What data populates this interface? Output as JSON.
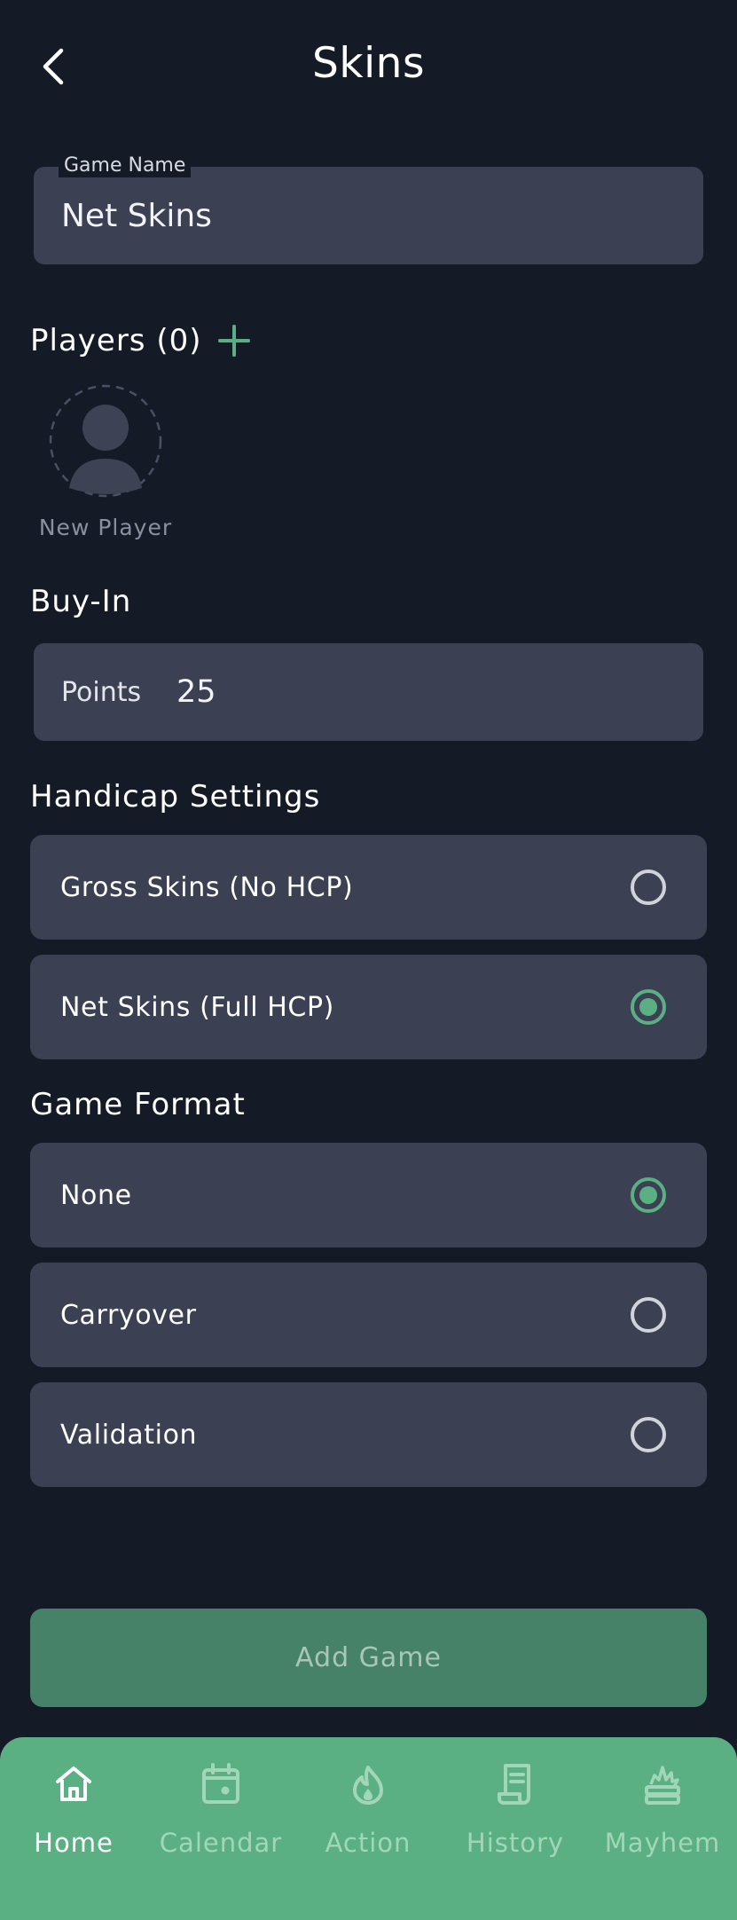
{
  "header": {
    "title": "Skins",
    "back_icon": "chevron-left-icon"
  },
  "game_name": {
    "label": "Game Name",
    "value": "Net Skins"
  },
  "players": {
    "title": "Players (0)",
    "add_icon": "plus-icon",
    "new_player_label": "New Player",
    "avatar_icon": "person-icon"
  },
  "buy_in": {
    "title": "Buy-In",
    "prefix": "Points",
    "value": "25"
  },
  "handicap": {
    "title": "Handicap Settings",
    "options": [
      {
        "label": "Gross Skins (No HCP)",
        "selected": false
      },
      {
        "label": "Net Skins (Full HCP)",
        "selected": true
      }
    ]
  },
  "format": {
    "title": "Game Format",
    "options": [
      {
        "label": "None",
        "selected": true
      },
      {
        "label": "Carryover",
        "selected": false
      },
      {
        "label": "Validation",
        "selected": false
      }
    ]
  },
  "action": {
    "add_game_label": "Add Game"
  },
  "tabs": [
    {
      "label": "Home",
      "icon": "home-icon",
      "active": true
    },
    {
      "label": "Calendar",
      "icon": "calendar-icon",
      "active": false
    },
    {
      "label": "Action",
      "icon": "flame-icon",
      "active": false
    },
    {
      "label": "History",
      "icon": "scroll-icon",
      "active": false
    },
    {
      "label": "Mayhem",
      "icon": "explosion-icon",
      "active": false
    }
  ],
  "colors": {
    "background": "#151a27",
    "card": "#3b4152",
    "accent": "#5bb083",
    "button": "#468268"
  }
}
